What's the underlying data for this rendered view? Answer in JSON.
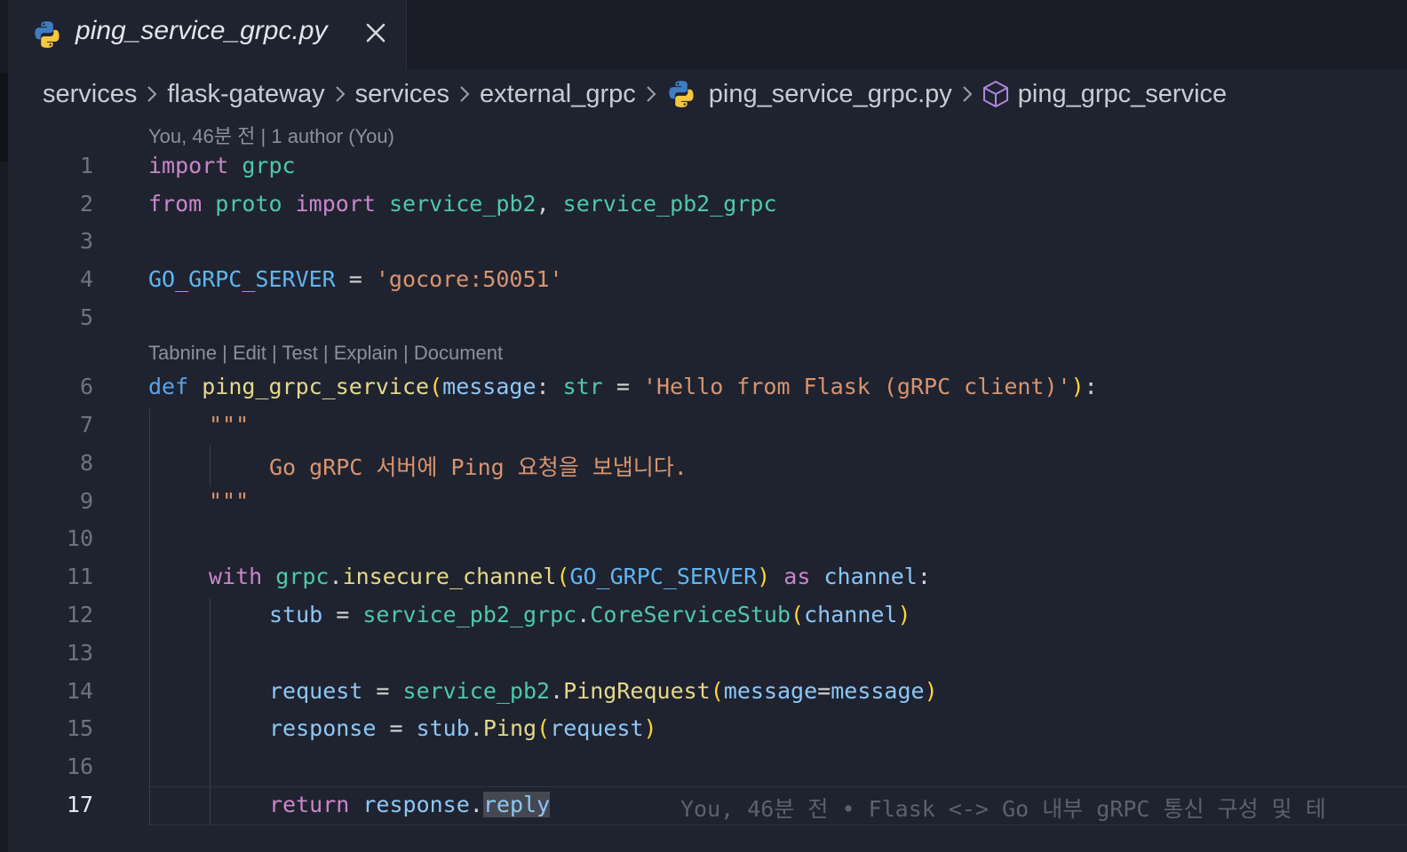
{
  "tab": {
    "title": "ping_service_grpc.py"
  },
  "breadcrumb": [
    "services",
    "flask-gateway",
    "services",
    "external_grpc",
    "ping_service_grpc.py",
    "ping_grpc_service"
  ],
  "codelens": {
    "blame": "You, 46분 전 | 1 author (You)",
    "actions": "Tabnine | Edit | Test | Explain | Document"
  },
  "line_numbers": [
    "1",
    "2",
    "3",
    "4",
    "5",
    "6",
    "7",
    "8",
    "9",
    "10",
    "11",
    "12",
    "13",
    "14",
    "15",
    "16",
    "17"
  ],
  "active_line": "17",
  "code": {
    "l1": [
      "import",
      " ",
      "grpc"
    ],
    "l2": [
      "from",
      " ",
      "proto",
      " ",
      "import",
      " ",
      "service_pb2",
      ", ",
      "service_pb2_grpc"
    ],
    "l4": [
      "GO_GRPC_SERVER",
      " = ",
      "'gocore:50051'"
    ],
    "l6": [
      "def",
      " ",
      "ping_grpc_service",
      "(",
      "message",
      ": ",
      "str",
      " = ",
      "'Hello from Flask (gRPC client)'",
      ")",
      ":"
    ],
    "l7": [
      "\"\"\""
    ],
    "l8": [
      "Go gRPC 서버에 Ping 요청을 보냅니다."
    ],
    "l9": [
      "\"\"\""
    ],
    "l11": [
      "with",
      " ",
      "grpc",
      ".",
      "insecure_channel",
      "(",
      "GO_GRPC_SERVER",
      ")",
      " ",
      "as",
      " ",
      "channel",
      ":"
    ],
    "l12": [
      "stub",
      " = ",
      "service_pb2_grpc",
      ".",
      "CoreServiceStub",
      "(",
      "channel",
      ")"
    ],
    "l14": [
      "request",
      " = ",
      "service_pb2",
      ".",
      "PingRequest",
      "(",
      "message",
      "=",
      "message",
      ")"
    ],
    "l15": [
      "response",
      " = ",
      "stub",
      ".",
      "Ping",
      "(",
      "request",
      ")"
    ],
    "l17": [
      "return",
      " ",
      "response",
      ".",
      "reply"
    ]
  },
  "inline_blame": "You, 46분 전 • Flask <-> Go 내부 gRPC 통신 구성 및 테",
  "colors": {
    "background": "#1f2330",
    "keyword": "#c986c9",
    "string": "#d9946e",
    "module": "#4ec9a8",
    "variable": "#8ec7f5",
    "function": "#e6d98a",
    "bracket": "#ffd43b"
  },
  "icons": {
    "tab": "python-icon",
    "close": "close-icon",
    "crumb_file": "python-icon",
    "crumb_symbol": "cube-icon",
    "separator": "chevron-right-icon"
  }
}
